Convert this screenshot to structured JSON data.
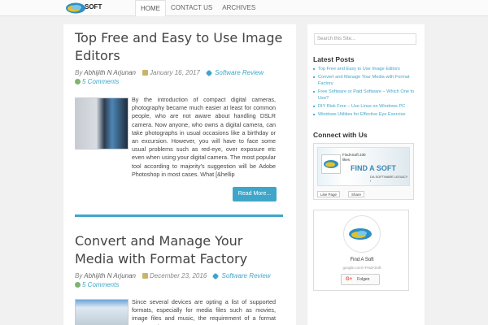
{
  "header": {
    "logo_text": "SOFT",
    "nav": [
      {
        "label": "HOME",
        "active": true
      },
      {
        "label": "CONTACT US",
        "active": false
      },
      {
        "label": "ARCHIVES",
        "active": false
      }
    ]
  },
  "posts": [
    {
      "title": "Top Free and Easy to Use Image Editors",
      "author": "Abhijith N Arjunan",
      "date": "January 16, 2017",
      "category": "Software Review",
      "comments": "5 Comments",
      "excerpt": "By the introduction of compact digital cameras, photography became much easier at least for common people, who are not aware about handling DSLR camera. Now anyone, who owns a digital camera, can take photographs in usual occasions like a birthday or an excursion. However, you will have to face some usual problems such as red-eye, over exposure etc even when using your digital camera. The most popular tool according to majority's suggestion will be Adobe Photoshop in most cases. What [&hellip",
      "more_label": "Read More..."
    },
    {
      "title": "Convert and Manage Your Media with Format Factory",
      "author": "Abhijith N Arjunan",
      "date": "December 23, 2016",
      "category": "Software Review",
      "comments": "5 Comments",
      "excerpt": "Since several devices are opting a list of supported formats, especially for media files such as movies, image files and music, the requirement of a format converter is"
    }
  ],
  "sidebar": {
    "search_placeholder": "Search this Site...",
    "latest_heading": "Latest Posts",
    "latest": [
      "Top Free and Easy to Use Image Editors",
      "Convert and Manage Your Media with Format Factory",
      "Free Software or Paid Software – Which One to Use?",
      "DIY Risk Free – Use Linux on Windows PC",
      "Windows Utilities for Effective Eye Exercise"
    ],
    "connect_heading": "Connect with Us",
    "facebook": {
      "page_small": "FindASoft 230 likes",
      "brand": "FIND A SOFT",
      "tagline": "DA SOFTWARE LEGACY !",
      "like_label": "Like Page",
      "share_label": "Share"
    },
    "gplus": {
      "name": "Find A Soft",
      "url": "google.com/+FindASoft",
      "follow_label": "Folgen",
      "g_label": "G+"
    }
  },
  "colors": {
    "accent": "#3fa6c9",
    "logo_blue": "#2e8fc4",
    "logo_yellow": "#e2c22a"
  }
}
